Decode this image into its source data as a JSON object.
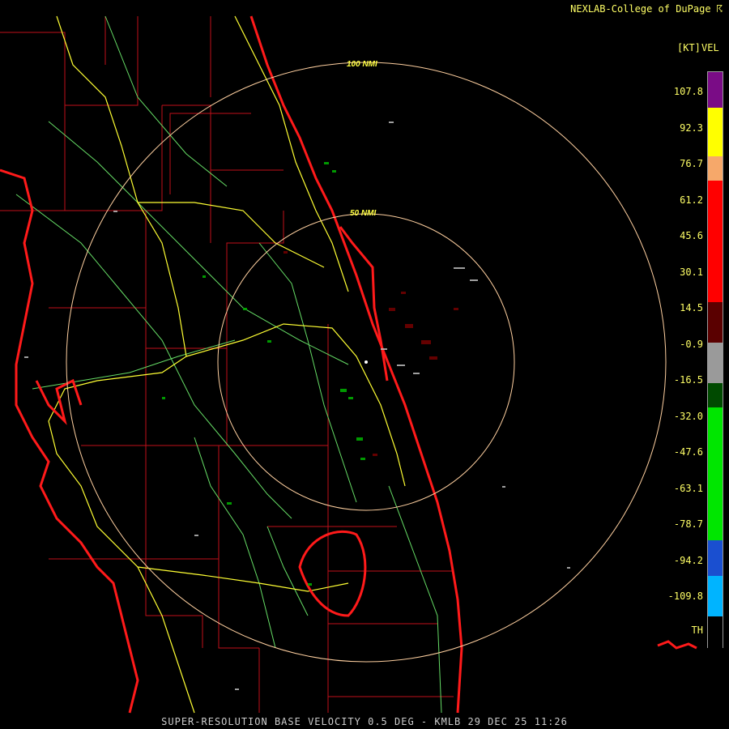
{
  "header": {
    "credit": "NEXLAB-College of DuPage ☈"
  },
  "legend": {
    "product_short": "VEL",
    "unit": "[KT]",
    "bottom_label": "TH",
    "ticks": [
      "107.8",
      "92.3",
      "76.7",
      "61.2",
      "45.6",
      "30.1",
      "14.5",
      "-0.9",
      "-16.5",
      "-32.0",
      "-47.6",
      "-63.1",
      "-78.7",
      "-94.2",
      "-109.8"
    ],
    "colors": {
      "purple": "#7a0c86",
      "yellow": "#ffff00",
      "orange": "#f6a86a",
      "red": "#ff0000",
      "dark_red": "#5a0000",
      "gray": "#9a9a9a",
      "dark_green": "#004a00",
      "green": "#00e600",
      "blue": "#1a4fd0",
      "cyan": "#00b4ff",
      "range_ring": "#ffd0a0",
      "county_lines": "#c0101a",
      "coastline": "#ff1a1a",
      "highways": "#ffff33",
      "roads": "#66dd66"
    }
  },
  "map": {
    "rings": [
      {
        "label": "100 NMI"
      },
      {
        "label": "50 NMI"
      }
    ],
    "icons": {
      "radar_site": "radar-site-icon"
    }
  },
  "caption": "SUPER-RESOLUTION BASE VELOCITY 0.5 DEG - KMLB 29 DEC 25 11:26"
}
